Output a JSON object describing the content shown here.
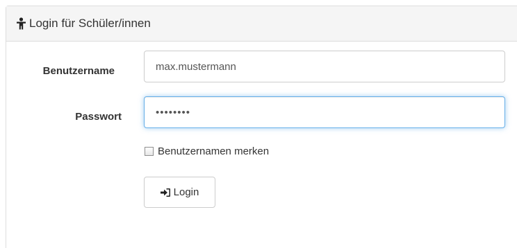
{
  "panel": {
    "title": "Login für Schüler/innen",
    "title_icon": "person-icon"
  },
  "form": {
    "username_label": "Benutzername",
    "username_value": "max.mustermann",
    "password_label": "Passwort",
    "password_value": "••••••••",
    "remember_label": "Benutzernamen merken",
    "remember_checked": false,
    "login_button": "Login",
    "login_icon": "sign-in-icon"
  },
  "colors": {
    "heading_bg": "#f5f5f5",
    "border": "#dddddd",
    "focus_border": "#66afe9"
  }
}
